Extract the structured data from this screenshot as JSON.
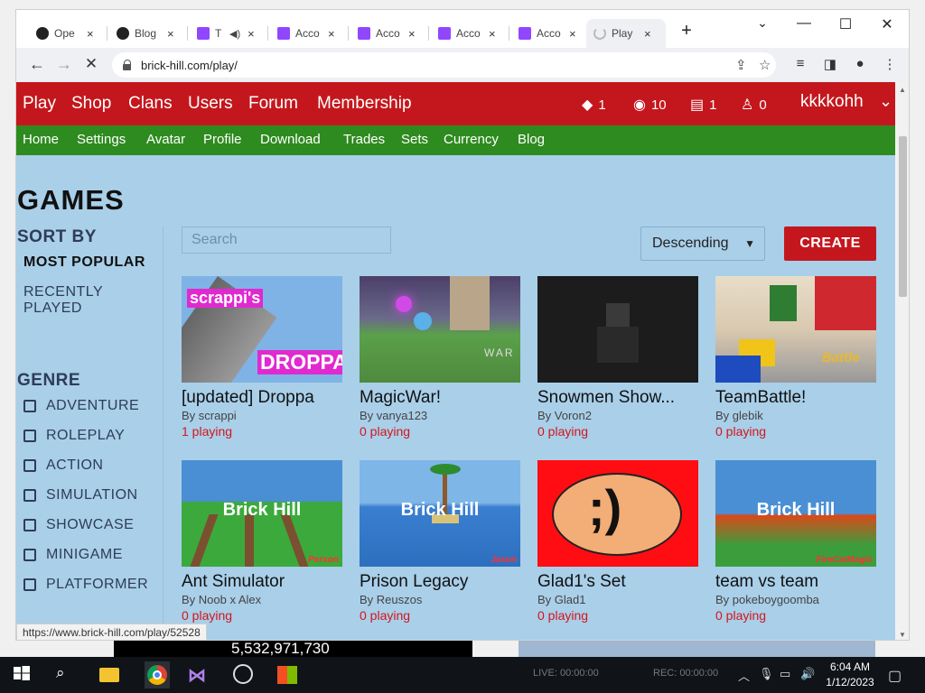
{
  "browser": {
    "tabs": [
      {
        "label": "Ope",
        "color": "#222"
      },
      {
        "label": "Blog",
        "color": "#222"
      },
      {
        "label": "T",
        "color": "#9146ff"
      },
      {
        "label": "Acco",
        "color": "#9146ff"
      },
      {
        "label": "Acco",
        "color": "#9146ff"
      },
      {
        "label": "Acco",
        "color": "#9146ff"
      },
      {
        "label": "Acco",
        "color": "#9146ff"
      },
      {
        "label": "Play",
        "color": "#aaa"
      }
    ],
    "close_glyph": "×",
    "new_tab_glyph": "+",
    "url": "brick-hill.com/play/",
    "status_url": "https://www.brick-hill.com/play/52528",
    "icons": [
      "back-icon",
      "forward-icon",
      "stop-icon",
      "share-icon",
      "star-icon",
      "reading-list-icon",
      "sidepanel-icon",
      "profile-icon",
      "menu-icon"
    ]
  },
  "topnav": {
    "links": [
      "Play",
      "Shop",
      "Clans",
      "Users",
      "Forum",
      "Membership"
    ],
    "stats": {
      "bricks": "1",
      "bucks": "10",
      "messages": "1",
      "friends": "0"
    },
    "username": "kkkkohh"
  },
  "subnav": {
    "links": [
      "Home",
      "Settings",
      "Avatar",
      "Profile",
      "Download",
      "Trades",
      "Sets",
      "Currency",
      "Blog"
    ]
  },
  "main": {
    "title": "GAMES",
    "sort_by_label": "SORT BY",
    "sort_options": [
      "MOST POPULAR",
      "RECENTLY",
      "PLAYED"
    ],
    "genre_label": "GENRE",
    "genres": [
      "ADVENTURE",
      "ROLEPLAY",
      "ACTION",
      "SIMULATION",
      "SHOWCASE",
      "MINIGAME",
      "PLATFORMER"
    ],
    "search_placeholder": "Search",
    "sort_select": "Descending",
    "create_label": "CREATE"
  },
  "games": [
    {
      "title": "[updated] Droppa",
      "author": "By scrappi",
      "playing": "1 playing",
      "thumb_text": "scrappi's",
      "thumb_text2": "DROPPA"
    },
    {
      "title": "MagicWar!",
      "author": "By vanya123",
      "playing": "0 playing",
      "thumb_text": "WAR"
    },
    {
      "title": "Snowmen Show...",
      "author": "By Voron2",
      "playing": "0 playing"
    },
    {
      "title": "TeamBattle!",
      "author": "By glebik",
      "playing": "0 playing",
      "thumb_text": "Battle"
    },
    {
      "title": "Ant Simulator",
      "author": "By Noob x Alex",
      "playing": "0 playing",
      "thumb_text": "Brick Hill",
      "thumb_sub": "Person"
    },
    {
      "title": "Prison Legacy",
      "author": "By Reuszos",
      "playing": "0 playing",
      "thumb_text": "Brick Hill",
      "thumb_sub": "Jason"
    },
    {
      "title": "Glad1's Set",
      "author": "By Glad1",
      "playing": "0 playing",
      "thumb_text": ";)"
    },
    {
      "title": "team vs team",
      "author": "By pokeboygoomba",
      "playing": "0 playing",
      "thumb_text": "Brick Hill",
      "thumb_sub": "FireCatMagic"
    }
  ],
  "overlay": {
    "counter": "5,532,971,730"
  },
  "taskbar": {
    "time": "6:04 AM",
    "date": "1/12/2023",
    "live": "LIVE: 00:00:00",
    "rec": "REC: 00:00:00"
  },
  "colors": {
    "nav_red": "#c4171d",
    "nav_green": "#2e8b1f",
    "page_bg": "#a9cfe9",
    "playing_red": "#d4151b"
  }
}
